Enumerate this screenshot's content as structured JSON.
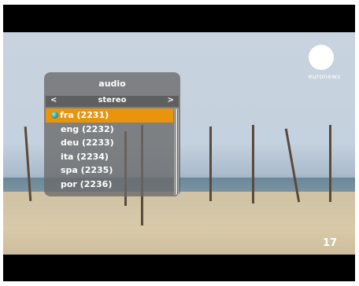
{
  "channel": {
    "logo_text": "euronews",
    "number": "17"
  },
  "audio_menu": {
    "title": "audio",
    "mode": {
      "left_arrow": "<",
      "value": "stereo",
      "right_arrow": ">"
    },
    "selected_index": 0,
    "items": [
      {
        "label": "fra (2231)"
      },
      {
        "label": "eng (2232)"
      },
      {
        "label": "deu (2233)"
      },
      {
        "label": "ita (2234)"
      },
      {
        "label": "spa (2235)"
      },
      {
        "label": "por (2236)"
      }
    ],
    "colors": {
      "highlight": "#e8950d",
      "panel": "#696969"
    }
  }
}
